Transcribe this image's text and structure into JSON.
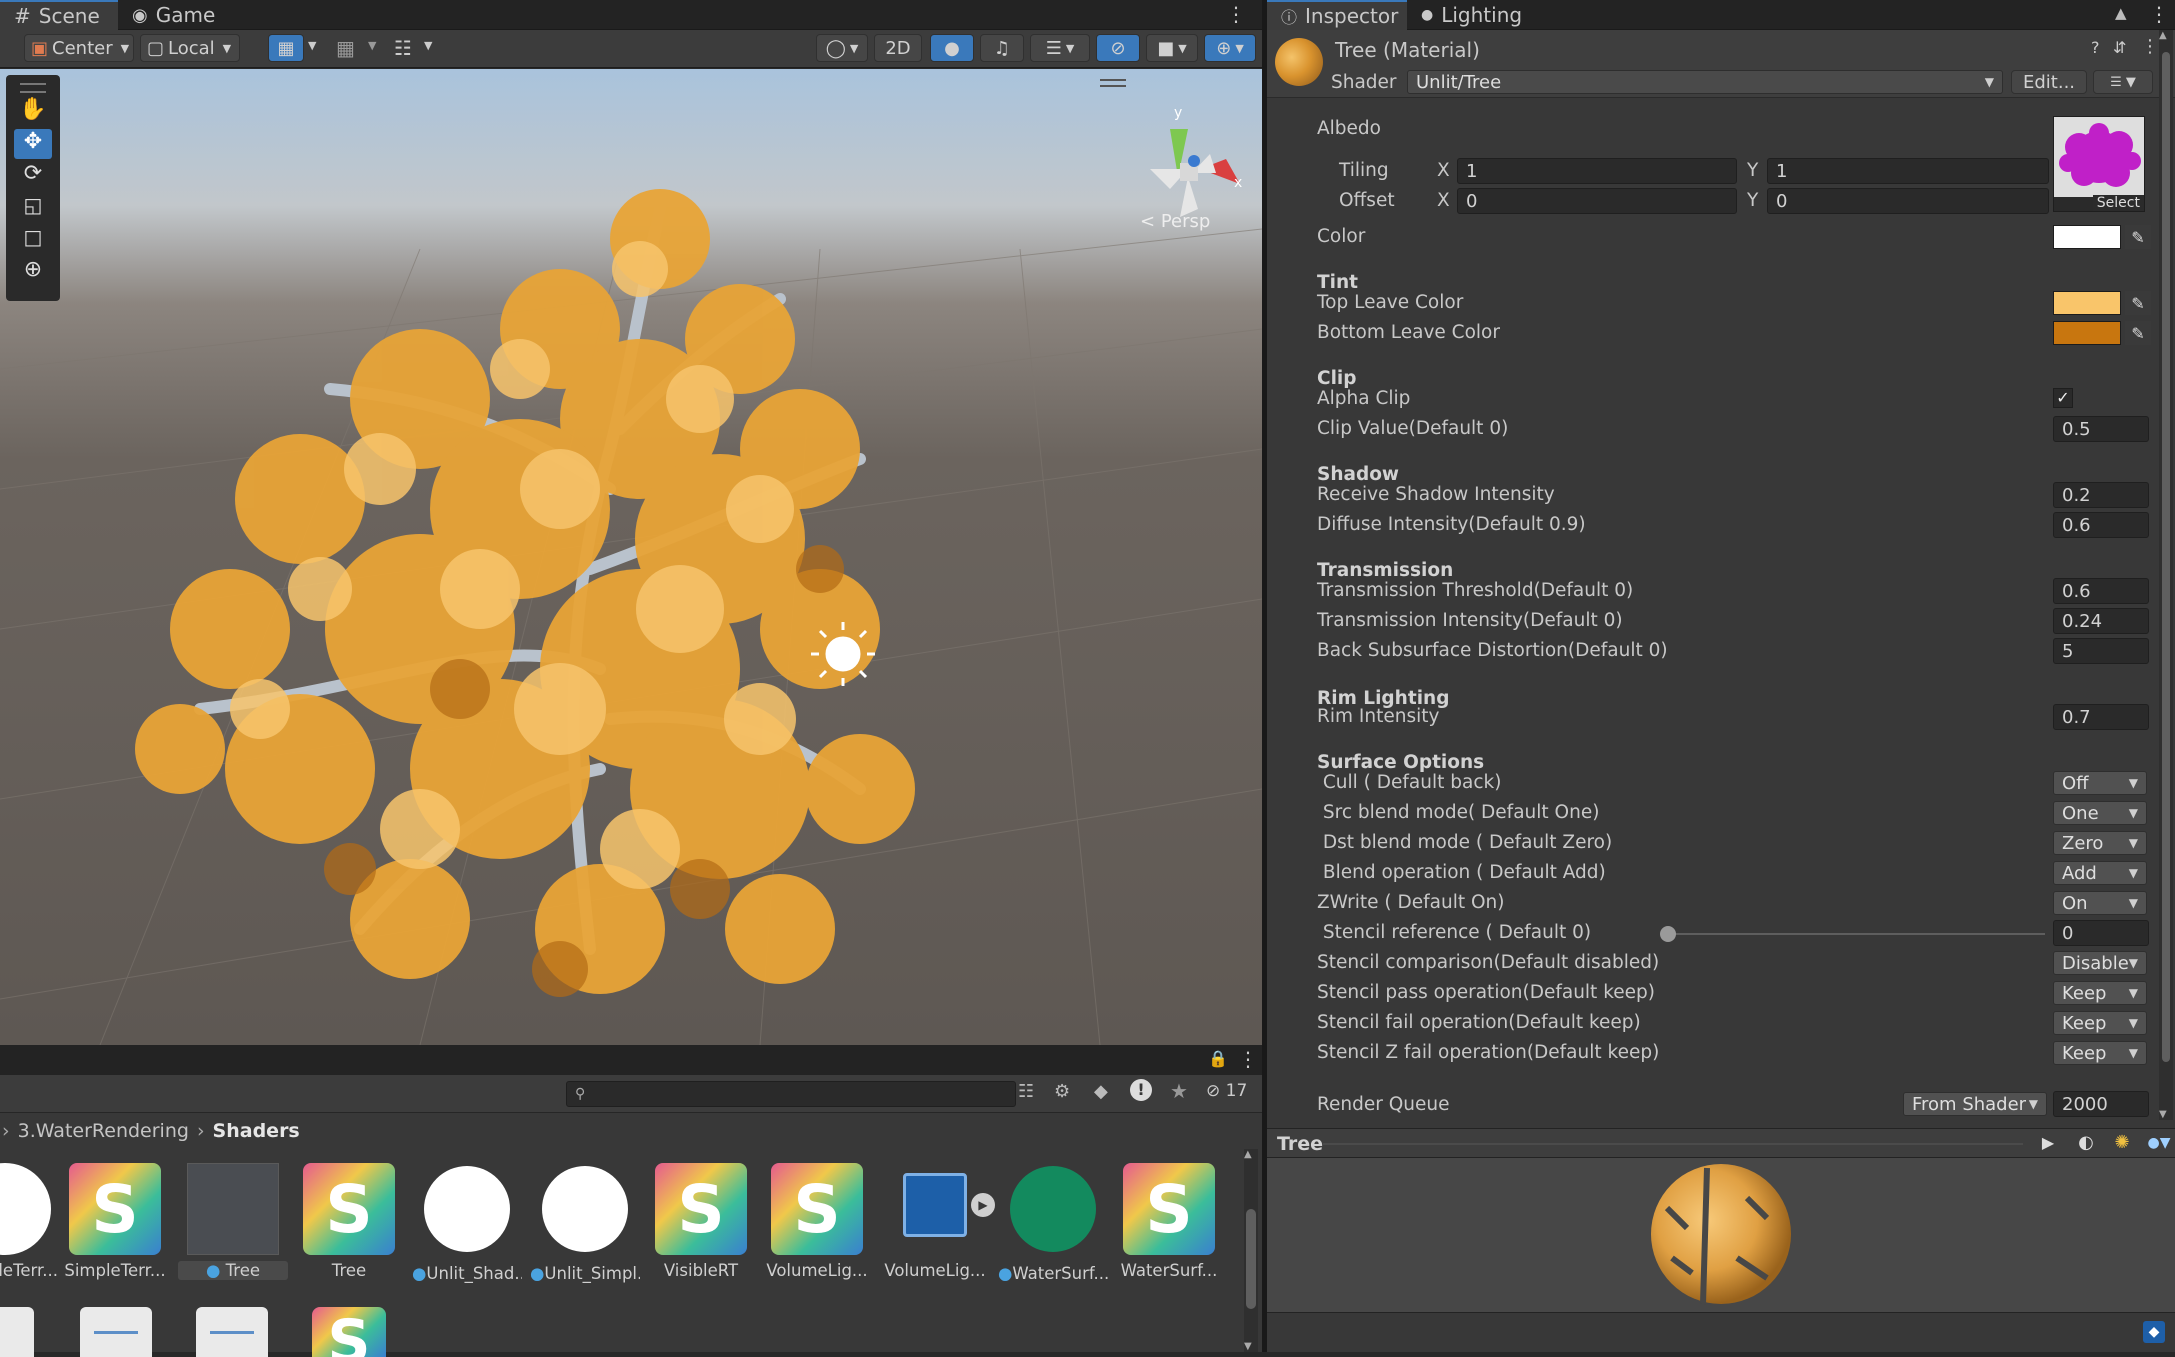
{
  "scene_panel": {
    "tabs": [
      {
        "label": "Scene",
        "icon": "hash-icon"
      },
      {
        "label": "Game",
        "icon": "gamepad-icon"
      }
    ],
    "toolbar": {
      "pivot": "Center",
      "space": "Local",
      "mode_2d": "2D"
    },
    "persp_label": "Persp",
    "gizmo_axes": [
      "y",
      "x"
    ]
  },
  "project_panel": {
    "breadcrumb": [
      "3.WaterRendering",
      "Shaders"
    ],
    "search_placeholder": "",
    "hidden_count": "17",
    "assets": [
      {
        "name": "leTerr...",
        "kind": "white-circle"
      },
      {
        "name": "SimpleTerr...",
        "kind": "shader"
      },
      {
        "name": "Tree",
        "kind": "material-dark",
        "selected": true
      },
      {
        "name": "Tree",
        "kind": "shader"
      },
      {
        "name": "Unlit_Shad...",
        "kind": "white-circle"
      },
      {
        "name": "Unlit_Simpl...",
        "kind": "white-circle"
      },
      {
        "name": "VisibleRT",
        "kind": "shader"
      },
      {
        "name": "VolumeLig...",
        "kind": "shader"
      },
      {
        "name": "VolumeLig...",
        "kind": "prefab"
      },
      {
        "name": "WaterSurf...",
        "kind": "green-circle"
      },
      {
        "name": "WaterSurf...",
        "kind": "shader"
      }
    ]
  },
  "inspector": {
    "tabs": [
      {
        "label": "Inspector",
        "icon": "info-icon"
      },
      {
        "label": "Lighting",
        "icon": "bulb-icon"
      }
    ],
    "material_title": "Tree (Material)",
    "shader_label": "Shader",
    "shader_value": "Unlit/Tree",
    "edit_button": "Edit...",
    "albedo": {
      "label": "Albedo",
      "tiling_label": "Tiling",
      "offset_label": "Offset",
      "x": "X",
      "y": "Y",
      "tiling_x": "1",
      "tiling_y": "1",
      "offset_x": "0",
      "offset_y": "0",
      "select_label": "Select"
    },
    "color_label": "Color",
    "colors": {
      "white": "#ffffff",
      "top_leave": "#f9c56a",
      "bottom_leave": "#c8760f",
      "accent": "#3a79bb",
      "texture": "#c020c8"
    },
    "tint": {
      "header": "Tint",
      "top_label": "Top Leave Color",
      "bottom_label": "Bottom Leave Color"
    },
    "clip": {
      "header": "Clip",
      "alpha_clip_label": "Alpha Clip",
      "alpha_clip_checked": true,
      "clip_value_label": "Clip Value(Default 0)",
      "clip_value": "0.5"
    },
    "shadow": {
      "header": "Shadow",
      "receive_label": "Receive Shadow Intensity",
      "receive_value": "0.2",
      "diffuse_label": "Diffuse Intensity(Default 0.9)",
      "diffuse_value": "0.6"
    },
    "transmission": {
      "header": "Transmission",
      "threshold_label": "Transmission Threshold(Default 0)",
      "threshold_value": "0.6",
      "intensity_label": "Transmission Intensity(Default 0)",
      "intensity_value": "0.24",
      "distortion_label": "Back Subsurface Distortion(Default 0)",
      "distortion_value": "5"
    },
    "rim": {
      "header": "Rim Lighting",
      "intensity_label": "Rim Intensity",
      "intensity_value": "0.7"
    },
    "surface": {
      "header": "Surface Options",
      "rows": [
        {
          "label": " Cull ( Default back)",
          "value": "Off"
        },
        {
          "label": " Src blend mode( Default One)",
          "value": "One"
        },
        {
          "label": " Dst blend mode ( Default Zero)",
          "value": "Zero"
        },
        {
          "label": " Blend operation ( Default Add)",
          "value": "Add"
        },
        {
          "label": "ZWrite ( Default On)",
          "value": "On"
        }
      ],
      "stencil_ref_label": " Stencil reference ( Default 0)",
      "stencil_ref_value": "0",
      "stencil_ref_fraction": 0,
      "stencil_rows": [
        {
          "label": "Stencil comparison(Default disabled)",
          "value": "Disable"
        },
        {
          "label": "Stencil pass operation(Default keep)",
          "value": "Keep"
        },
        {
          "label": "Stencil fail operation(Default keep)",
          "value": "Keep"
        },
        {
          "label": "Stencil Z fail operation(Default keep)",
          "value": "Keep"
        }
      ]
    },
    "render_queue": {
      "label": "Render Queue",
      "mode": "From Shader",
      "value": "2000"
    },
    "preview": {
      "title": "Tree"
    }
  }
}
